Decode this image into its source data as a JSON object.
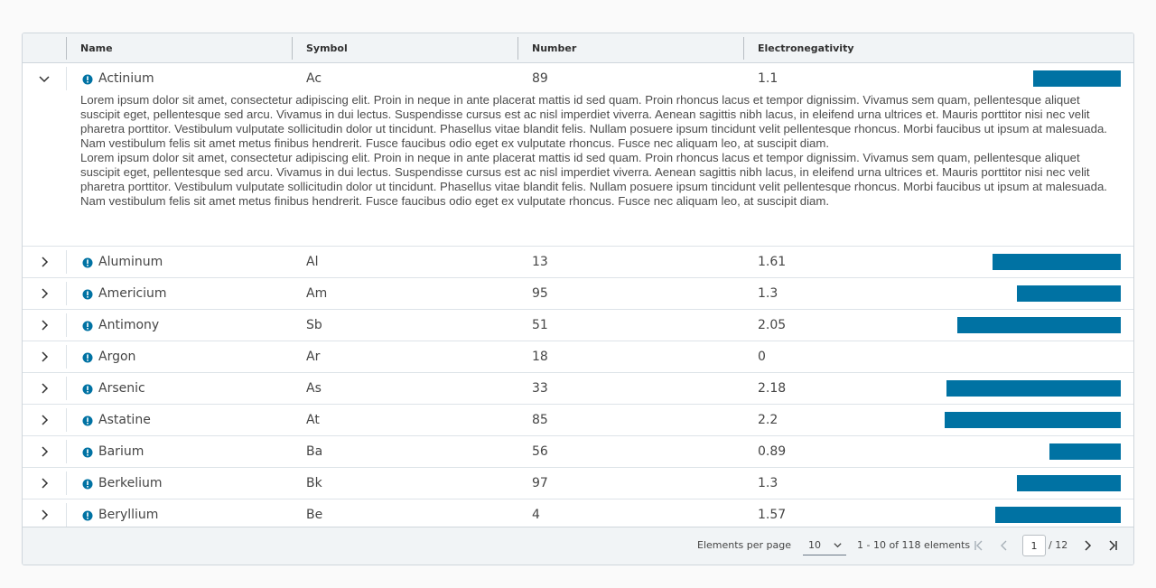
{
  "columns": {
    "name": "Name",
    "symbol": "Symbol",
    "number": "Number",
    "electronegativity": "Electronegativity"
  },
  "rows": [
    {
      "name": "Actinium",
      "symbol": "Ac",
      "number": "89",
      "electronegativity": "1.1",
      "en_value": 1.1,
      "expanded": true
    },
    {
      "name": "Aluminum",
      "symbol": "Al",
      "number": "13",
      "electronegativity": "1.61",
      "en_value": 1.61
    },
    {
      "name": "Americium",
      "symbol": "Am",
      "number": "95",
      "electronegativity": "1.3",
      "en_value": 1.3
    },
    {
      "name": "Antimony",
      "symbol": "Sb",
      "number": "51",
      "electronegativity": "2.05",
      "en_value": 2.05
    },
    {
      "name": "Argon",
      "symbol": "Ar",
      "number": "18",
      "electronegativity": "0",
      "en_value": 0
    },
    {
      "name": "Arsenic",
      "symbol": "As",
      "number": "33",
      "electronegativity": "2.18",
      "en_value": 2.18
    },
    {
      "name": "Astatine",
      "symbol": "At",
      "number": "85",
      "electronegativity": "2.2",
      "en_value": 2.2
    },
    {
      "name": "Barium",
      "symbol": "Ba",
      "number": "56",
      "electronegativity": "0.89",
      "en_value": 0.89
    },
    {
      "name": "Berkelium",
      "symbol": "Bk",
      "number": "97",
      "electronegativity": "1.3",
      "en_value": 1.3
    },
    {
      "name": "Beryllium",
      "symbol": "Be",
      "number": "4",
      "electronegativity": "1.57",
      "en_value": 1.57
    }
  ],
  "detail_paragraphs": [
    "Lorem ipsum dolor sit amet, consectetur adipiscing elit. Proin in neque in ante placerat mattis id sed quam. Proin rhoncus lacus et tempor dignissim. Vivamus sem quam, pellentesque aliquet suscipit eget, pellentesque sed arcu. Vivamus in dui lectus. Suspendisse cursus est ac nisl imperdiet viverra. Aenean sagittis nibh lacus, in eleifend urna ultrices et. Mauris porttitor nisi nec velit pharetra porttitor. Vestibulum vulputate sollicitudin dolor ut tincidunt. Phasellus vitae blandit felis. Nullam posuere ipsum tincidunt velit pellentesque rhoncus. Morbi faucibus ut ipsum at malesuada. Nam vestibulum felis sit amet metus finibus hendrerit. Fusce faucibus odio eget ex vulputate rhoncus. Fusce nec aliquam leo, at suscipit diam.",
    "Lorem ipsum dolor sit amet, consectetur adipiscing elit. Proin in neque in ante placerat mattis id sed quam. Proin rhoncus lacus et tempor dignissim. Vivamus sem quam, pellentesque aliquet suscipit eget, pellentesque sed arcu. Vivamus in dui lectus. Suspendisse cursus est ac nisl imperdiet viverra. Aenean sagittis nibh lacus, in eleifend urna ultrices et. Mauris porttitor nisi nec velit pharetra porttitor. Vestibulum vulputate sollicitudin dolor ut tincidunt. Phasellus vitae blandit felis. Nullam posuere ipsum tincidunt velit pellentesque rhoncus. Morbi faucibus ut ipsum at malesuada. Nam vestibulum felis sit amet metus finibus hendrerit. Fusce faucibus odio eget ex vulputate rhoncus. Fusce nec aliquam leo, at suscipit diam."
  ],
  "footer": {
    "page_size_label": "Elements per page",
    "page_size_value": "10",
    "range_text": "1 - 10 of 118 elements",
    "current_page": "1",
    "total_pages": "/ 12"
  },
  "icons": {
    "row_status": "info-circle-icon",
    "expand": "chevron-right-icon",
    "collapse": "chevron-down-icon",
    "first_page": "first-page-icon",
    "prev_page": "chevron-left-icon",
    "next_page": "chevron-right-icon",
    "last_page": "last-page-icon"
  },
  "colors": {
    "accent": "#0072a3",
    "header_bg": "#f1f4f6",
    "border": "#cfd6dc"
  }
}
